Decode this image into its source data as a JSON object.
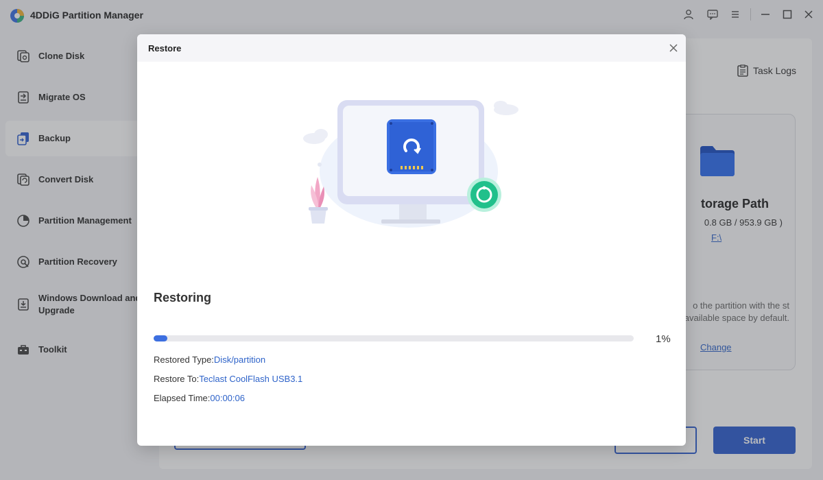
{
  "app": {
    "title": "4DDiG Partition Manager"
  },
  "sidebar": {
    "items": [
      {
        "label": "Clone Disk",
        "icon": "clone-disk-icon"
      },
      {
        "label": "Migrate OS",
        "icon": "migrate-os-icon"
      },
      {
        "label": "Backup",
        "icon": "backup-icon",
        "active": true
      },
      {
        "label": "Convert Disk",
        "icon": "convert-disk-icon"
      },
      {
        "label": "Partition Management",
        "icon": "partition-management-icon"
      },
      {
        "label": "Partition Recovery",
        "icon": "partition-recovery-icon"
      },
      {
        "label": "Windows Download and Upgrade",
        "icon": "windows-download-icon"
      },
      {
        "label": "Toolkit",
        "icon": "toolkit-icon"
      }
    ]
  },
  "main": {
    "task_logs": "Task Logs",
    "storage": {
      "title": "torage Path",
      "size": "0.8 GB / 953.9 GB )",
      "drive": "F:\\",
      "note": "o the partition with the st available space by default.",
      "change": "Change"
    },
    "start_label": "Start"
  },
  "modal": {
    "title": "Restore",
    "status": "Restoring",
    "progress_percent": 1,
    "progress_text": "1%",
    "restored_type_label": "Restored Type:",
    "restored_type_value": "Disk/partition",
    "restore_to_label": "Restore To:",
    "restore_to_value": "Teclast CoolFlash USB3.1",
    "elapsed_label": "Elapsed Time:",
    "elapsed_value": "00:00:06"
  },
  "colors": {
    "accent": "#2f5fd0",
    "link": "#2e63c9",
    "progress": "#3d6fe0"
  }
}
